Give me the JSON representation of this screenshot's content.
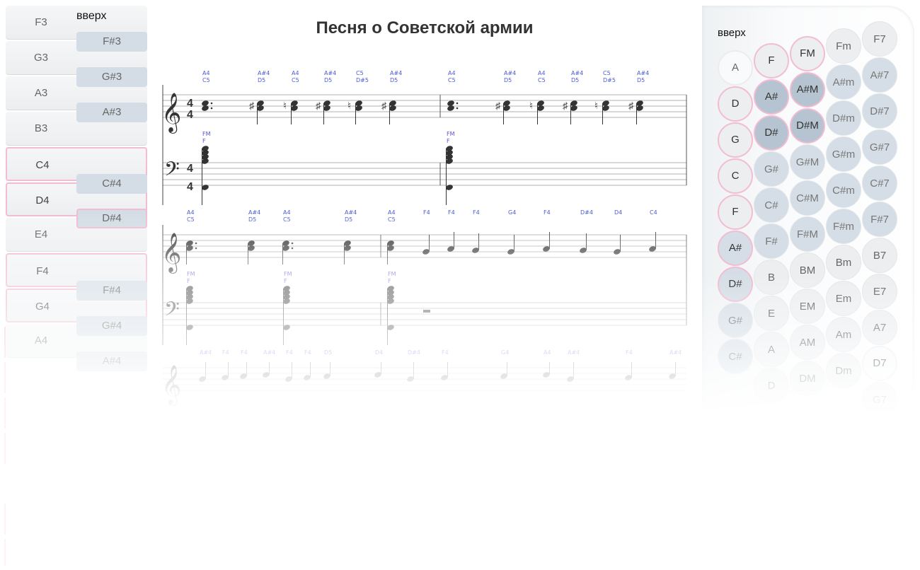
{
  "keyboard": {
    "up_label": "вверх",
    "white_keys": [
      "F3",
      "G3",
      "A3",
      "B3",
      "C4",
      "D4",
      "E4",
      "F4",
      "G4",
      "A4"
    ],
    "black_keys": [
      "F#3",
      "G#3",
      "A#3",
      "C#4",
      "D#4",
      "F#4",
      "G#4",
      "A#4"
    ]
  },
  "sheet": {
    "title": "Песня о Советской армии",
    "row1_treble_labels": [
      [
        "A4",
        "C5"
      ],
      [
        "A#4",
        "D5"
      ],
      [
        "A4",
        "C5"
      ],
      [
        "A#4",
        "D5"
      ],
      [
        "C5",
        "D#5"
      ],
      [
        "A#4",
        "D5"
      ],
      [
        "A4",
        "C5"
      ],
      [
        "A#4",
        "D5"
      ],
      [
        "A4",
        "C5"
      ],
      [
        "A#4",
        "D5"
      ],
      [
        "C5",
        "D#5"
      ],
      [
        "A#4",
        "D5"
      ]
    ],
    "row1_bass_labels": [
      [
        "FM",
        "F"
      ],
      [
        "FM",
        "F"
      ]
    ],
    "row2_treble_labels": [
      [
        "A4",
        "C5"
      ],
      [
        "A#4",
        "D5"
      ],
      [
        "A4",
        "C5"
      ],
      [
        "A#4",
        "D5"
      ],
      [
        "A4",
        "C5"
      ],
      [
        "F4"
      ],
      [
        "F4"
      ],
      [
        "F4"
      ],
      [
        "G4"
      ],
      [
        "F4"
      ],
      [
        "D#4"
      ],
      [
        "D4"
      ],
      [
        "C4"
      ]
    ],
    "row2_bass_labels": [
      [
        "FM",
        "F"
      ],
      [
        "FM",
        "F"
      ],
      [
        "FM",
        "F"
      ]
    ],
    "row3_treble_labels": [
      "A#4",
      "F4",
      "F4",
      "A#4",
      "F4",
      "F4",
      "D5",
      "D4",
      "D#4",
      "F4",
      "G4",
      "A4",
      "A#4",
      "F4",
      "A#4"
    ],
    "time_signature": [
      "4",
      "4"
    ]
  },
  "accordion": {
    "up_label": "вверх",
    "col1": [
      "A",
      "D",
      "G",
      "C",
      "F",
      "A#",
      "D#",
      "G#",
      "C#"
    ],
    "col2": [
      "F",
      "A#",
      "D#",
      "G#",
      "C#",
      "F#",
      "B",
      "E",
      "A",
      "D"
    ],
    "col3": [
      "FM",
      "A#M",
      "D#M",
      "G#M",
      "C#M",
      "F#M",
      "BM",
      "EM",
      "AM",
      "DM"
    ],
    "col4": [
      "Fm",
      "A#m",
      "D#m",
      "G#m",
      "C#m",
      "F#m",
      "Bm",
      "Em",
      "Am",
      "Dm"
    ],
    "col5": [
      "F7",
      "A#7",
      "D#7",
      "G#7",
      "C#7",
      "F#7",
      "B7",
      "E7",
      "A7",
      "D7",
      "G7"
    ]
  }
}
